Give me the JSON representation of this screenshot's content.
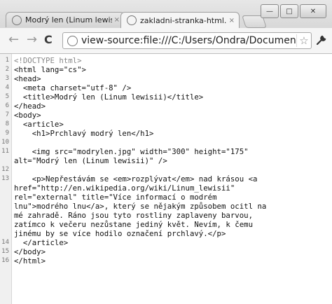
{
  "window": {
    "controls": {
      "minimize": "—",
      "maximize": "□",
      "close": "✕"
    }
  },
  "tabs": [
    {
      "title": "Modrý len (Linum lewisii)",
      "close": "×"
    },
    {
      "title": "zakladni-stranka-html.html",
      "close": "×"
    }
  ],
  "toolbar": {
    "back": "←",
    "forward": "→",
    "reload": "C",
    "url": "view-source:file:///C:/Users/Ondra/Documents/Pi",
    "star": "☆",
    "wrench": "🔧"
  },
  "source": {
    "lines": [
      {
        "n": "1",
        "text": "<!DOCTYPE html>"
      },
      {
        "n": "2",
        "text": "<html lang=\"cs\">"
      },
      {
        "n": "3",
        "text": "<head>"
      },
      {
        "n": "4",
        "text": "  <meta charset=\"utf-8\" />"
      },
      {
        "n": "5",
        "text": "  <title>Modrý len (Linum lewisii)</title>"
      },
      {
        "n": "6",
        "text": "</head>"
      },
      {
        "n": "7",
        "text": "<body>"
      },
      {
        "n": "8",
        "text": "  <article>"
      },
      {
        "n": "9",
        "text": "    <h1>Prchlavý modrý len</h1>"
      },
      {
        "n": "10",
        "text": ""
      },
      {
        "n": "11",
        "text": "    <img src=\"modrylen.jpg\" width=\"300\" height=\"175\""
      },
      {
        "n": "",
        "text": "alt=\"Modrý len (Linum lewisii)\" />"
      },
      {
        "n": "12",
        "text": ""
      },
      {
        "n": "13",
        "text": "    <p>Nepřestávám se <em>rozplývat</em> nad krásou <a"
      },
      {
        "n": "",
        "text": "href=\"http://en.wikipedia.org/wiki/Linum_lewisii\""
      },
      {
        "n": "",
        "text": "rel=\"external\" title=\"Více informací o modrém"
      },
      {
        "n": "",
        "text": "lnu\">modrého lnu</a>, který se nějakým způsobem ocitl na"
      },
      {
        "n": "",
        "text": "mé zahradě. Ráno jsou tyto rostliny zaplaveny barvou,"
      },
      {
        "n": "",
        "text": "zatímco k večeru nezůstane jediný květ. Nevím, k čemu"
      },
      {
        "n": "",
        "text": "jinému by se více hodilo označení prchlavý.</p>"
      },
      {
        "n": "14",
        "text": "  </article>"
      },
      {
        "n": "15",
        "text": "</body>"
      },
      {
        "n": "16",
        "text": "</html>"
      }
    ]
  }
}
